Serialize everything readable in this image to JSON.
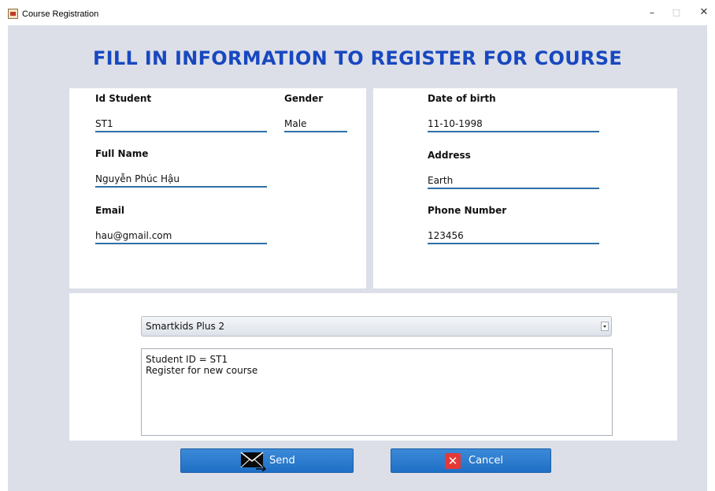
{
  "window": {
    "title": "Course Registration",
    "minimize": "–",
    "maximize": "□",
    "close": "✕"
  },
  "form": {
    "heading": "FILL IN INFORMATION TO REGISTER FOR COURSE",
    "id_student": {
      "label": "Id Student",
      "value": "ST1"
    },
    "gender": {
      "label": "Gender",
      "value": "Male"
    },
    "full_name": {
      "label": "Full Name",
      "value": "Nguyễn Phúc Hậu"
    },
    "email": {
      "label": "Email",
      "value": "hau@gmail.com"
    },
    "date_of_birth": {
      "label": "Date of birth",
      "value": "11-10-1998"
    },
    "address": {
      "label": "Address",
      "value": "Earth"
    },
    "phone_number": {
      "label": "Phone Number",
      "value": "123456"
    }
  },
  "course": {
    "selected": "Smartkids Plus 2"
  },
  "message": {
    "lines": [
      "Student ID = ST1",
      "Register for new course"
    ]
  },
  "buttons": {
    "send_label": "Send",
    "cancel_label": "Cancel",
    "cancel_icon_glyph": "✕"
  },
  "icons": {
    "send": "envelope-icon",
    "cancel": "x-icon"
  },
  "colors": {
    "heading": "#1848c0",
    "field_underline": "#2f6fa8",
    "button": "#2a7bd0",
    "cancel_icon": "#e53935",
    "background": "#dcdfe7"
  }
}
